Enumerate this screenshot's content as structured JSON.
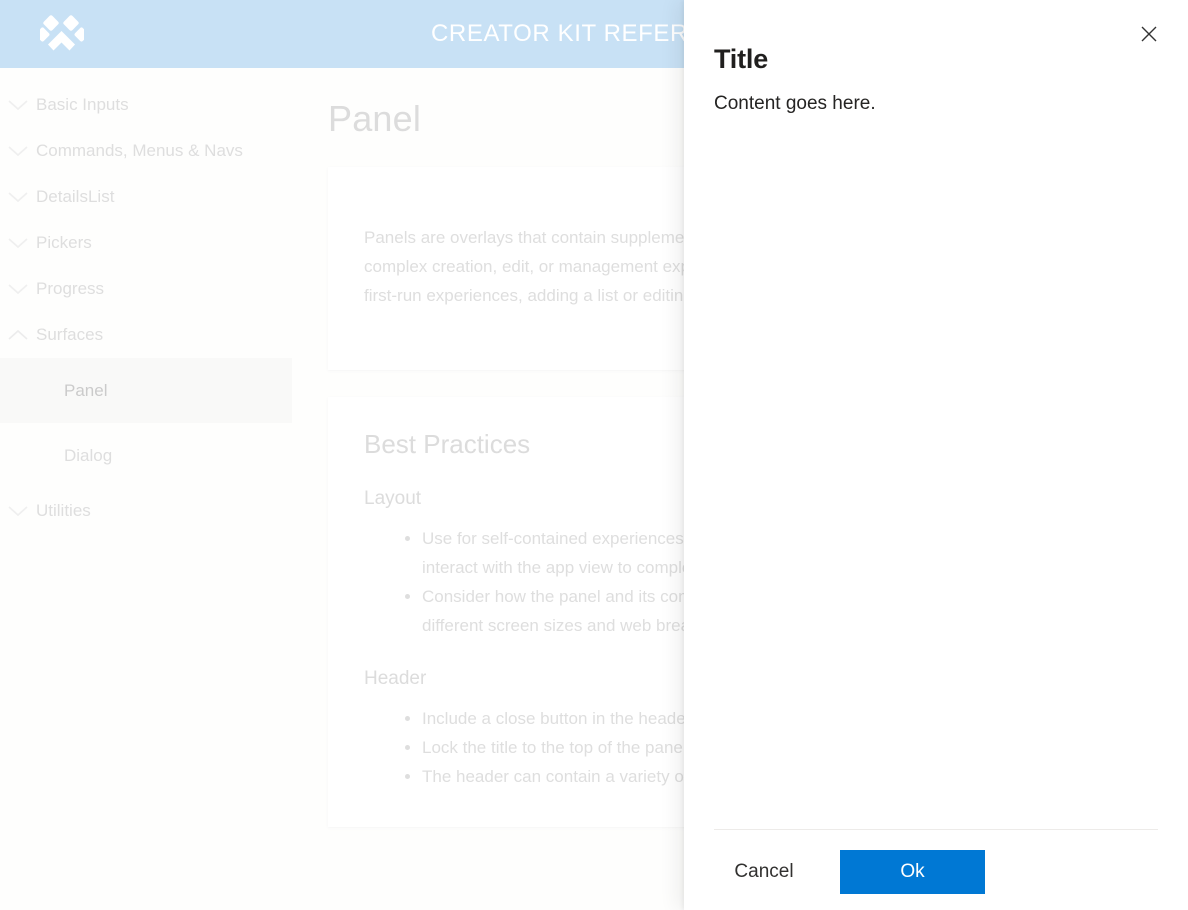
{
  "topbar": {
    "title": "CREATOR KIT REFERENCE",
    "logo_icon": "paw-diamond-logo-icon",
    "background_color": "#a3cdef"
  },
  "sidebar": {
    "groups": [
      {
        "label": "Basic Inputs",
        "icon": "chevron-down-icon",
        "expanded": false,
        "children": []
      },
      {
        "label": "Commands, Menus & Navs",
        "icon": "chevron-down-icon",
        "expanded": false,
        "children": []
      },
      {
        "label": "DetailsList",
        "icon": "chevron-down-icon",
        "expanded": false,
        "children": []
      },
      {
        "label": "Pickers",
        "icon": "chevron-down-icon",
        "expanded": false,
        "children": []
      },
      {
        "label": "Progress",
        "icon": "chevron-down-icon",
        "expanded": false,
        "children": []
      },
      {
        "label": "Surfaces",
        "icon": "chevron-up-icon",
        "expanded": true,
        "children": [
          {
            "label": "Panel",
            "selected": true
          },
          {
            "label": "Dialog",
            "selected": false
          }
        ]
      },
      {
        "label": "Utilities",
        "icon": "chevron-down-icon",
        "expanded": false,
        "children": []
      }
    ]
  },
  "main": {
    "page_title": "Panel",
    "intro_paragraph": "Panels are overlays that contain supplementary content and are used for complex creation, edit, or management experiences. Examples include first-run experiences, adding a list or editing settings.",
    "best_practices": {
      "heading": "Best Practices",
      "sections": [
        {
          "heading": "Layout",
          "items": [
            "Use for self-contained experiences where the user does not need to interact with the app view to complete the task.",
            "Consider how the panel and its contained contents will adapt to different screen sizes and web breakpoints."
          ]
        },
        {
          "heading": "Header",
          "items": [
            "Include a close button in the header of the panel.",
            "Lock the title to the top of the panel.",
            "The header can contain a variety of components."
          ]
        }
      ]
    }
  },
  "panel": {
    "title": "Title",
    "content": "Content goes here.",
    "close_icon": "close-x-icon",
    "footer": {
      "cancel_label": "Cancel",
      "ok_label": "Ok",
      "primary_color": "#0078d4"
    }
  }
}
